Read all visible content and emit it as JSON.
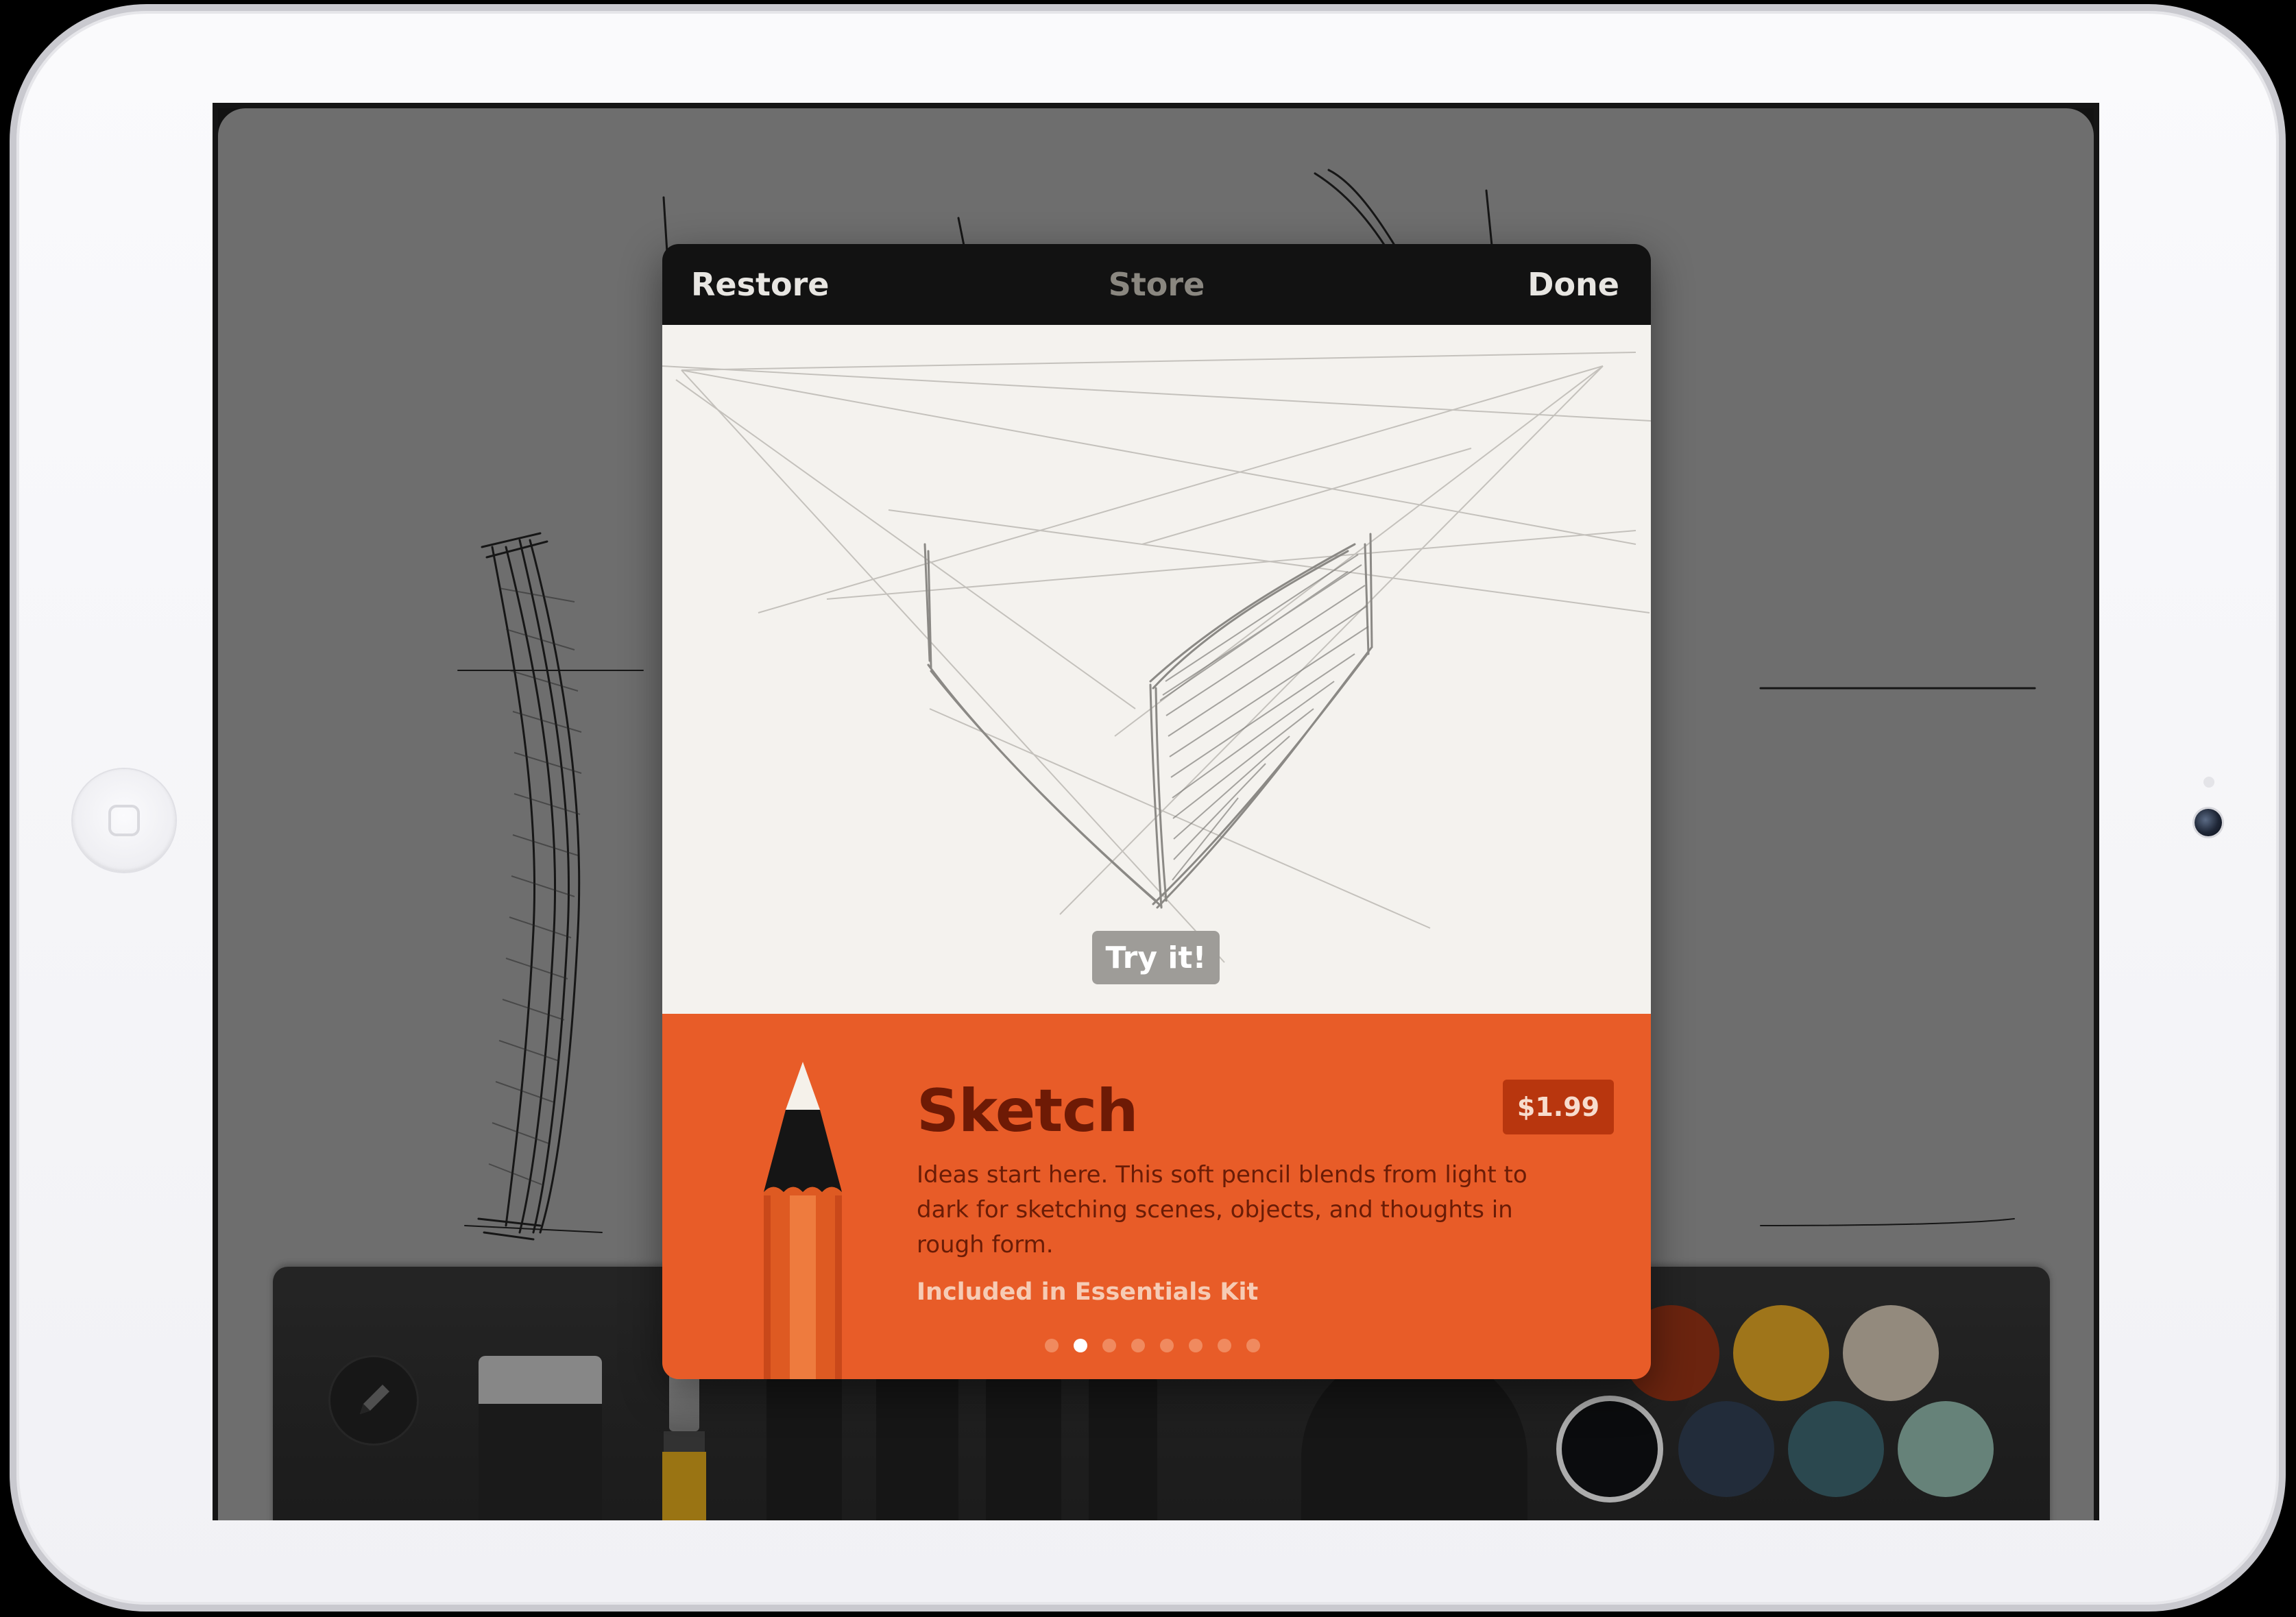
{
  "store": {
    "restore_label": "Restore",
    "title": "Store",
    "done_label": "Done",
    "try_it_label": "Try it!"
  },
  "product": {
    "name": "Sketch",
    "price": "$1.99",
    "description": "Ideas start here. This soft pencil blends from light to dark for sketching scenes, objects, and thoughts in rough form.",
    "kit": "Included in Essentials Kit",
    "page_count": 8,
    "active_page": 2,
    "icon": "pencil-icon"
  },
  "toolbar": {
    "tools": [
      "pencil-icon",
      "eraser",
      "brush",
      "pen",
      "marker",
      "pencil",
      "crayon",
      "blender"
    ],
    "palette": [
      "#7a2a12",
      "#b6861e",
      "#a89e8f",
      "#0d0e10",
      "#273342",
      "#32535a",
      "#75958a"
    ],
    "selected_color": "#0d0e10"
  },
  "colors": {
    "accent": "#e85c28",
    "title_text": "#6e1a05",
    "price_badge": "#b8360e",
    "header": "#121212"
  }
}
